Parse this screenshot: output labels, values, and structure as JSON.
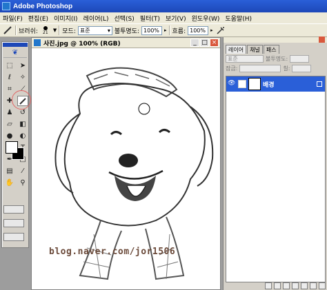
{
  "app": {
    "title": "Adobe Photoshop"
  },
  "menu": [
    "파일(F)",
    "편집(E)",
    "이미지(I)",
    "레이어(L)",
    "선택(S)",
    "필터(T)",
    "보기(V)",
    "윈도우(W)",
    "도움말(H)"
  ],
  "options": {
    "brush_label": "브러쉬:",
    "brush_size": "21",
    "mode_label": "모드:",
    "mode_value": "표준",
    "opacity_label": "불투명도:",
    "opacity_value": "100%",
    "flow_label": "흐름:",
    "flow_value": "100%"
  },
  "document": {
    "title": "사진.jpg @ 100% (RGB)",
    "watermark": "blog.naver.com/jor1506"
  },
  "panel": {
    "tabs": [
      "레이어",
      "채널",
      "패스"
    ],
    "blend_value": "표준",
    "opacity_label": "불투명도:",
    "lock_label": "잠금:",
    "fill_label": "칠:",
    "layers": [
      {
        "name": "배경"
      }
    ]
  },
  "colors": {
    "titlebar": "#1d48b8",
    "selection": "#2a5fd8",
    "annotation": "#e26565"
  }
}
